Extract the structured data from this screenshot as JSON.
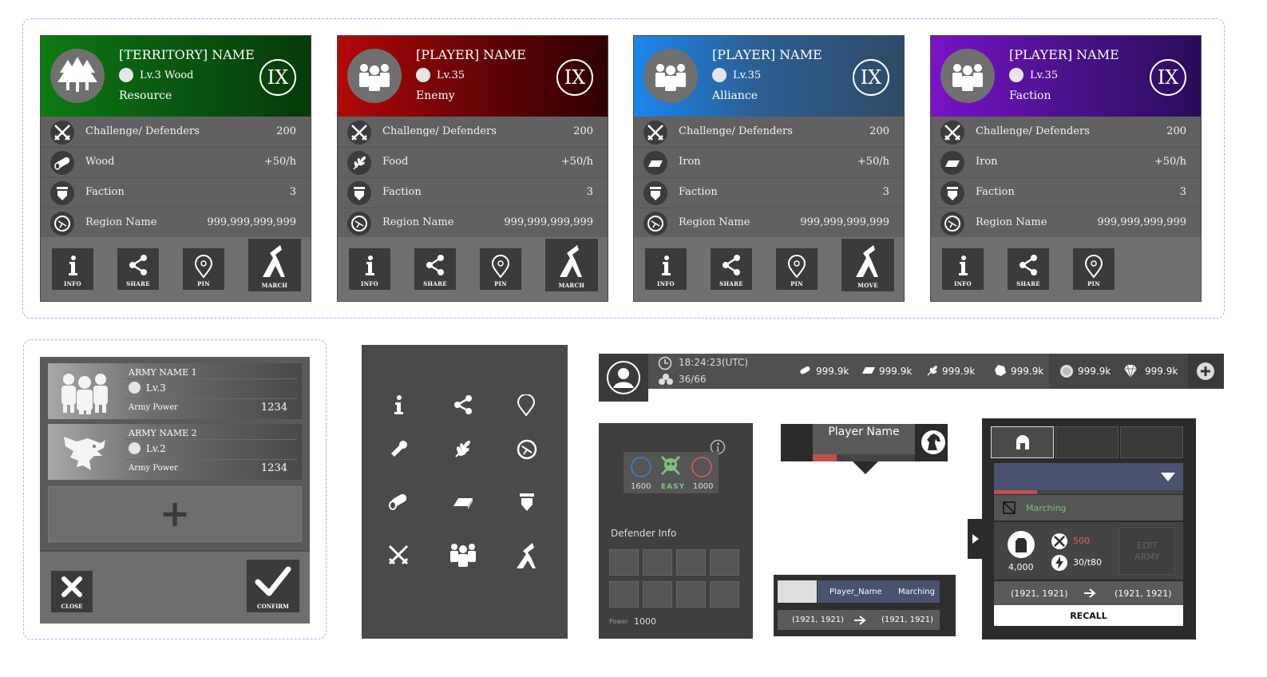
{
  "cards": [
    {
      "title": "[TERRITORY] NAME",
      "level": "Lv.3 Wood",
      "subtitle": "Resource",
      "badge": "IX",
      "rows": [
        {
          "label": "Challenge/ Defenders",
          "value": "200"
        },
        {
          "label": "Wood",
          "value": "+50/h"
        },
        {
          "label": "Faction",
          "value": "3"
        },
        {
          "label": "Region Name",
          "value": "999,999,999,999"
        }
      ],
      "buttons": [
        "INFO",
        "SHARE",
        "PIN",
        "MARCH"
      ]
    },
    {
      "title": "[PLAYER] NAME",
      "level": "Lv.35",
      "subtitle": "Enemy",
      "badge": "IX",
      "rows": [
        {
          "label": "Challenge/ Defenders",
          "value": "200"
        },
        {
          "label": "Food",
          "value": "+50/h"
        },
        {
          "label": "Faction",
          "value": "3"
        },
        {
          "label": "Region Name",
          "value": "999,999,999,999"
        }
      ],
      "buttons": [
        "INFO",
        "SHARE",
        "PIN",
        "MARCH"
      ]
    },
    {
      "title": "[PLAYER] NAME",
      "level": "Lv.35",
      "subtitle": "Alliance",
      "badge": "IX",
      "rows": [
        {
          "label": "Challenge/ Defenders",
          "value": "200"
        },
        {
          "label": "Iron",
          "value": "+50/h"
        },
        {
          "label": "Faction",
          "value": "3"
        },
        {
          "label": "Region Name",
          "value": "999,999,999,999"
        }
      ],
      "buttons": [
        "INFO",
        "SHARE",
        "PIN",
        "MOVE"
      ]
    },
    {
      "title": "[PLAYER] NAME",
      "level": "Lv.35",
      "subtitle": "Faction",
      "badge": "IX",
      "rows": [
        {
          "label": "Challenge/ Defenders",
          "value": "200"
        },
        {
          "label": "Iron",
          "value": "+50/h"
        },
        {
          "label": "Faction",
          "value": "3"
        },
        {
          "label": "Region Name",
          "value": "999,999,999,999"
        }
      ],
      "buttons": [
        "INFO",
        "SHARE",
        "PIN"
      ]
    }
  ],
  "army": {
    "armies": [
      {
        "name": "ARMY NAME 1",
        "level": "Lv.3",
        "power_label": "Army Power",
        "power": "1234"
      },
      {
        "name": "ARMY NAME 2",
        "level": "Lv.2",
        "power_label": "Army Power",
        "power": "1234"
      }
    ],
    "add_symbol": "+",
    "close_label": "CLOSE",
    "confirm_label": "CONFIRM"
  },
  "topbar": {
    "time": "18:24:23(UTC)",
    "slots": "36/66",
    "resources": [
      "999.9k",
      "999.9k",
      "999.9k",
      "999.9k",
      "999.9k",
      "999.9k"
    ]
  },
  "defender": {
    "values": [
      "1600",
      "EASY",
      "1000"
    ],
    "title": "Defender Info",
    "power_label": "Power",
    "power": "1000"
  },
  "player_tag": {
    "name": "Player Name"
  },
  "march_row": {
    "player": "Player_Name",
    "status": "Marching",
    "from": "(1921, 1921)",
    "to": "(1921, 1921)"
  },
  "march_panel": {
    "status": "Marching",
    "count": "4,000",
    "stat1": "500",
    "stat2": "30/t80",
    "edit": "EDIT ARMY",
    "from": "(1921, 1921)",
    "to": "(1921, 1921)",
    "recall": "RECALL"
  },
  "colors": {
    "territory": "#0d7a12",
    "enemy": "#b30808",
    "alliance": "#1c86ee",
    "faction": "#7a12c9",
    "easy": "#7bc47f",
    "danger": "#e05a5a"
  }
}
